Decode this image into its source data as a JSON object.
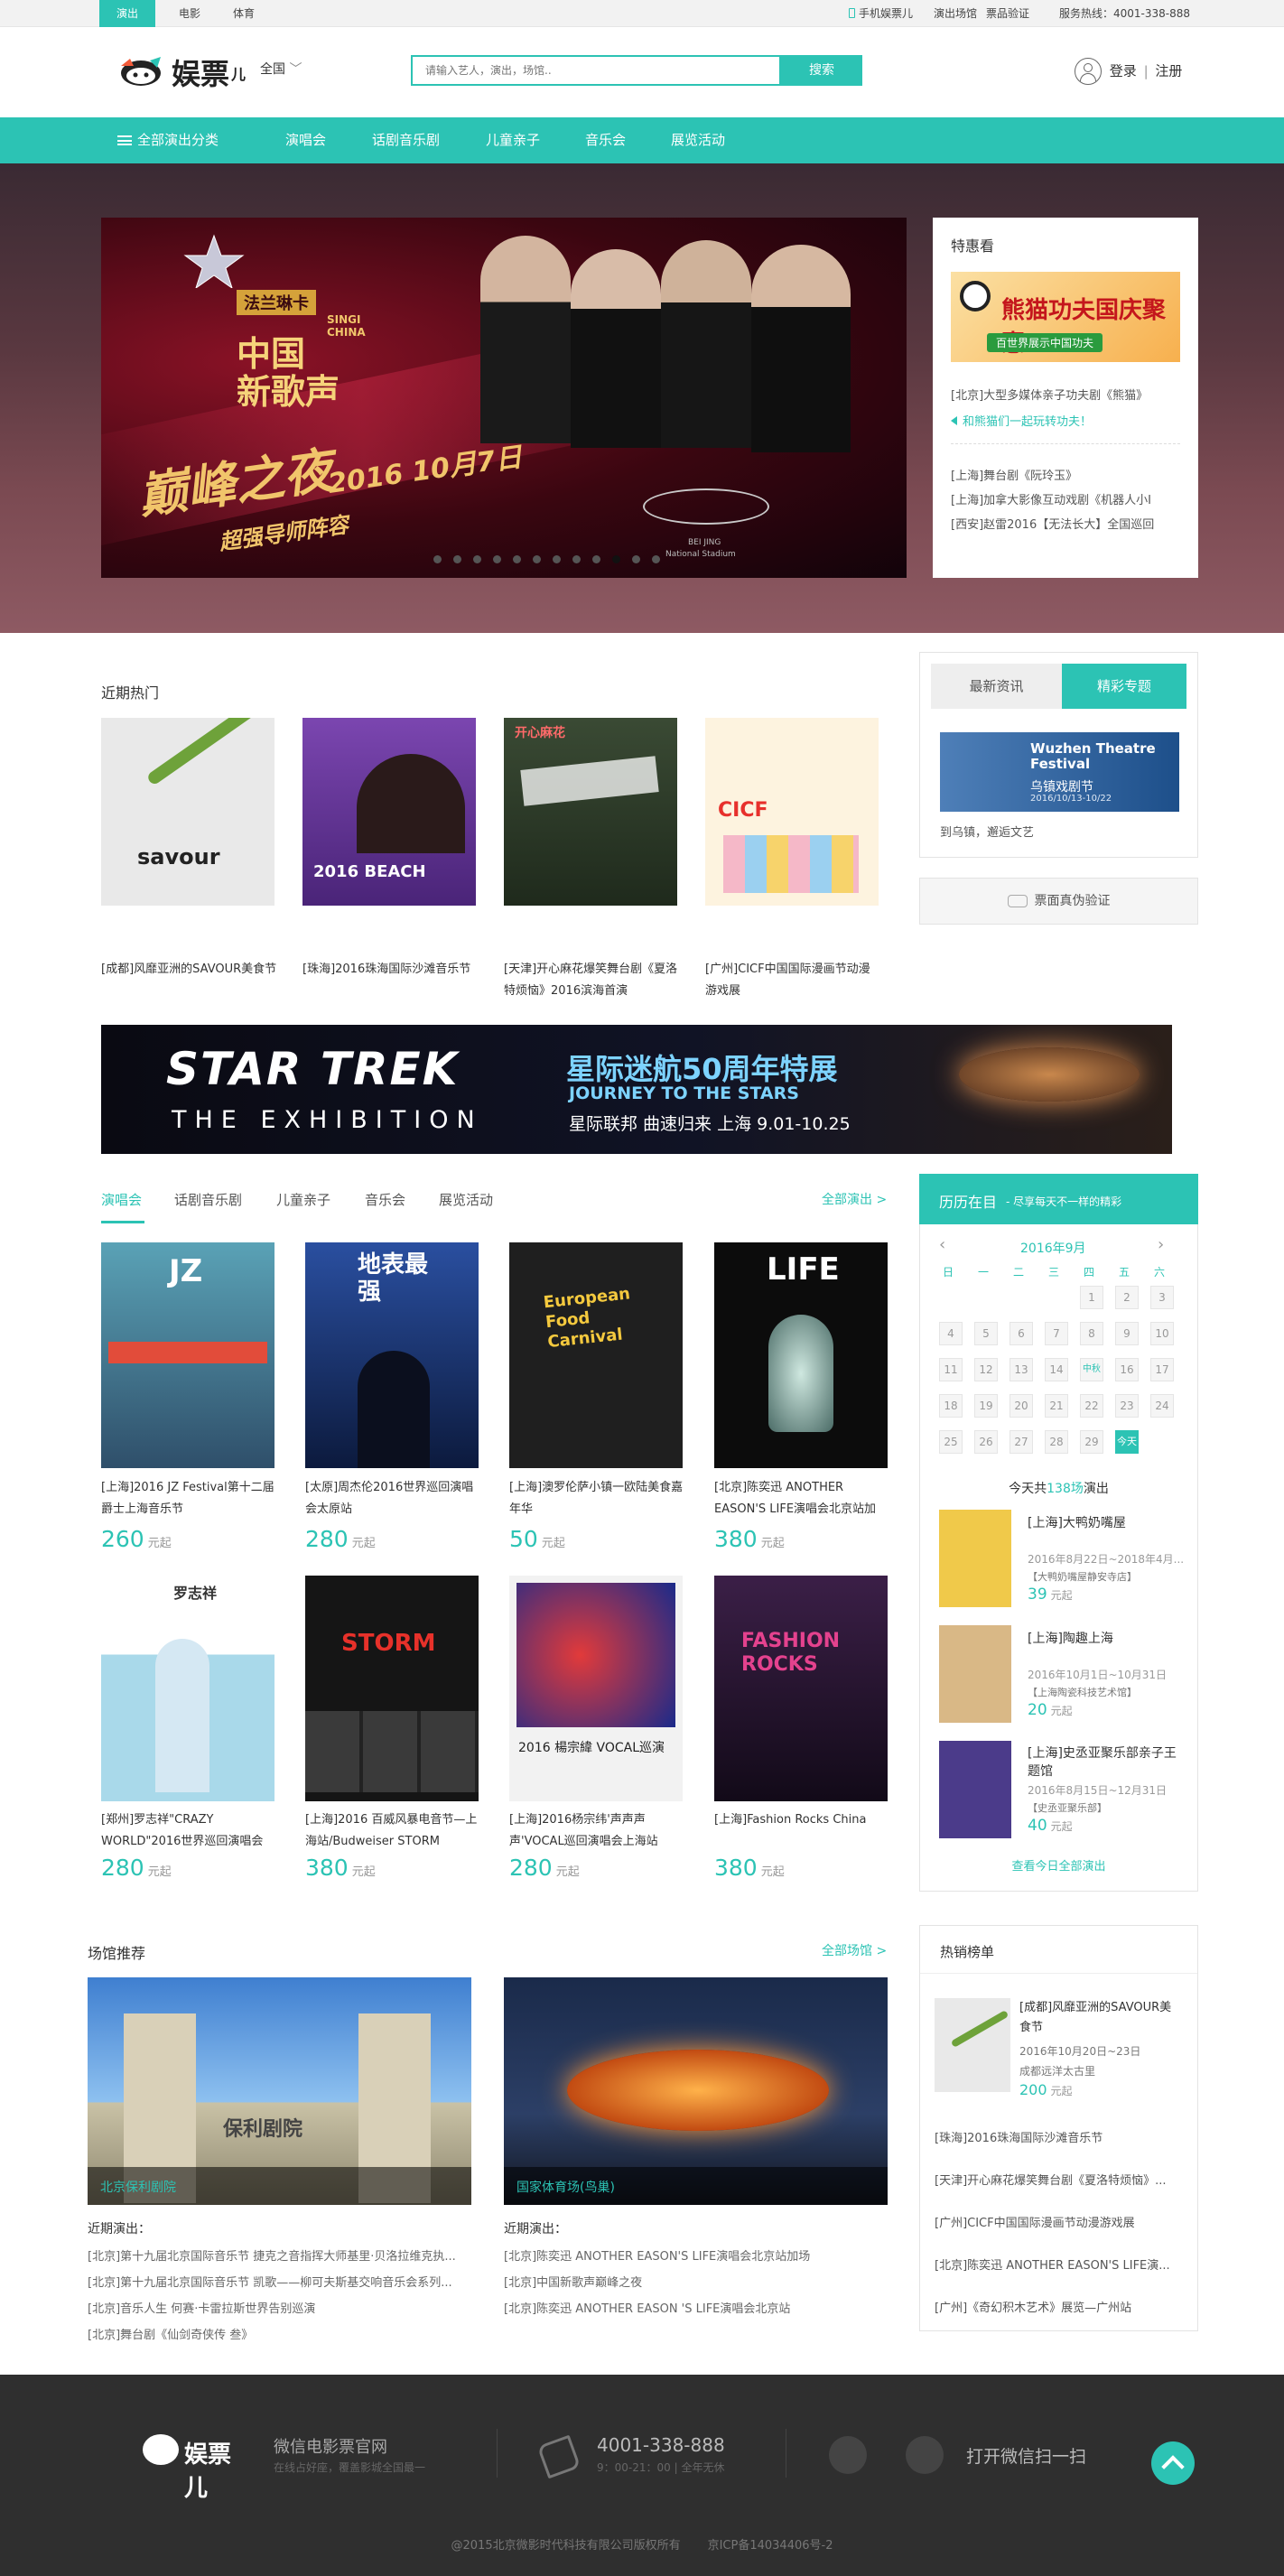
{
  "topbar": {
    "tabs": [
      "演出",
      "电影",
      "体育"
    ],
    "mobile": "手机娱票儿",
    "venues": "演出场馆",
    "verify": "票品验证",
    "hotline": "服务热线：4001-338-888"
  },
  "header": {
    "logo_text": "娱票",
    "logo_sub": "儿",
    "city": "全国",
    "search_placeholder": "请输入艺人，演出，场馆..",
    "search_button": "搜索",
    "login": "登录",
    "divider": "|",
    "register": "注册"
  },
  "nav": {
    "all_categories": "全部演出分类",
    "items": [
      "演唱会",
      "话剧音乐剧",
      "儿童亲子",
      "音乐会",
      "展览活动"
    ]
  },
  "hero": {
    "brand_en": "SINGI CHINA",
    "brand": "法兰琳卡",
    "title_1": "中国",
    "title_2": "新歌声",
    "event_title": "巅峰之夜",
    "date": "2016 10月7日",
    "subtitle": "超强导师阵容",
    "venue_en": "BEI JING",
    "venue": "National Stadium"
  },
  "tehui": {
    "title": "特惠看",
    "banner_text": "熊猫功夫国庆聚惠",
    "banner_sub": "百世界展示中国功夫",
    "items": [
      "[北京]大型多媒体亲子功夫剧《熊猫》",
      "和熊猫们一起玩转功夫！",
      "[上海]舞台剧《阮玲玉》",
      "[上海]加拿大影像互动戏剧《机器人小I",
      "[西安]赵雷2016【无法长大】全国巡回"
    ]
  },
  "hot": {
    "title": "近期热门",
    "items": [
      {
        "caption": "[成都]风靡亚洲的SAVOUR美食节",
        "poster_text": "savour",
        "color": "#e6e6e6"
      },
      {
        "caption": "[珠海]2016珠海国际沙滩音乐节",
        "poster_text": "2016 BEACH",
        "color": "#6a3fa0"
      },
      {
        "caption": "[天津]开心麻花爆笑舞台剧《夏洛特烦恼》2016滨海首演",
        "poster_text": "开心麻花",
        "color": "#2f3a2c"
      },
      {
        "caption": "[广州]CICF中国国际漫画节动漫游戏展",
        "poster_text": "CICF",
        "color": "#fde9c8"
      }
    ]
  },
  "tabs_panel": {
    "tab_news": "最新资讯",
    "tab_feature": "精彩专题",
    "festival_en": "Wuzhen Theatre Festival",
    "festival_cn": "乌镇戏剧节",
    "festival_date": "2016/10/13-10/22",
    "festival_caption": "到乌镇，邂逅文艺",
    "verify_button": "票面真伪验证"
  },
  "star_trek": {
    "logo": "STAR TREK",
    "sub": "THE EXHIBITION",
    "cn_title": "星际迷航50周年特展",
    "en_sub": "JOURNEY TO THE STARS",
    "cn_sub": "星际联邦 曲速归来 上海 9.01-10.25"
  },
  "shows": {
    "tabs": [
      "演唱会",
      "话剧音乐剧",
      "儿童亲子",
      "音乐会",
      "展览活动"
    ],
    "all_link": "全部演出 >",
    "currency_suffix": "元起",
    "items": [
      {
        "caption": "[上海]2016 JZ Festival第十二届爵士上海音乐节",
        "price": "260",
        "poster_text": "JZ",
        "color": "#4b7d8f"
      },
      {
        "caption": "[太原]周杰伦2016世界巡回演唱会太原站",
        "price": "280",
        "poster_text": "地表最强",
        "color": "#223c7a"
      },
      {
        "caption": "[上海]澳罗伦萨小镇一欧陆美食嘉年华",
        "price": "50",
        "poster_text": "European Food Carnival",
        "color": "#1f1f1f"
      },
      {
        "caption": "[北京]陈奕迅 ANOTHER EASON'S LIFE演唱会北京站加",
        "price": "380",
        "poster_text": "LIFE",
        "color": "#0c0c0c"
      },
      {
        "caption": "[郑州]罗志祥\"CRAZY WORLD\"2016世界巡回演唱会",
        "price": "280",
        "poster_text": "罗志祥",
        "color": "#9bd1e0"
      },
      {
        "caption": "[上海]2016 百威风暴电音节—上海站/Budweiser STORM",
        "price": "380",
        "poster_text": "STORM",
        "color": "#151515"
      },
      {
        "caption": "[上海]2016杨宗纬'声声声声'VOCAL巡回演唱会上海站",
        "price": "280",
        "poster_text": "2016 楊宗緯 VOCAL巡演",
        "color": "#f2f2f2"
      },
      {
        "caption": "[上海]Fashion Rocks China",
        "price": "380",
        "poster_text": "FASHION ROCKS",
        "color": "#2a1533"
      }
    ]
  },
  "calendar": {
    "title": "历历在目",
    "subtitle": "- 尽享每天不一样的精彩",
    "month": "2016年9月",
    "prev": "‹",
    "next": "›",
    "weekdays": [
      "日",
      "一",
      "二",
      "三",
      "四",
      "五",
      "六"
    ],
    "days": [
      "",
      "",
      "",
      "",
      "1",
      "2",
      "3",
      "4",
      "5",
      "6",
      "7",
      "8",
      "9",
      "10",
      "11",
      "12",
      "13",
      "14",
      "中秋",
      "16",
      "17",
      "18",
      "19",
      "20",
      "21",
      "22",
      "23",
      "24",
      "25",
      "26",
      "27",
      "28",
      "29",
      "今天",
      ""
    ],
    "today_prefix": "今天共",
    "today_count": "138场",
    "today_suffix": "演出",
    "events": [
      {
        "title": "[上海]大鸭奶嘴屋",
        "date": "2016年8月22日~2018年4月...",
        "venue": "【大鸭奶嘴屋静安寺店】",
        "price": "39",
        "color": "#f0c94a"
      },
      {
        "title": "[上海]陶趣上海",
        "date": "2016年10月1日~10月31日",
        "venue": "【上海陶瓷科技艺术馆】",
        "price": "20",
        "color": "#d9b886"
      },
      {
        "title": "[上海]史丞亚聚乐部亲子王题馆",
        "date": "2016年8月15日~12月31日",
        "venue": "【史丞亚聚乐部】",
        "price": "40",
        "color": "#4b3b8a"
      }
    ],
    "all_today": "查看今日全部演出"
  },
  "venues": {
    "title": "场馆推荐",
    "all_link": "全部场馆 >",
    "recent_label": "近期演出：",
    "items": [
      {
        "name": "北京保利剧院",
        "photo_text": "保利剧院",
        "shows": [
          "[北京]第十九届北京国际音乐节 捷克之音指挥大师基里·贝洛拉维克执...",
          "[北京]第十九届北京国际音乐节 凯歌——柳可夫斯基交响音乐会系列...",
          "[北京]音乐人生 何赛·卡雷拉斯世界告别巡演",
          "[北京]舞台剧《仙剑奇侠传 叁》"
        ]
      },
      {
        "name": "国家体育场(鸟巢)",
        "photo_text": "",
        "shows": [
          "[北京]陈奕迅 ANOTHER EASON'S LIFE演唱会北京站加场",
          "[北京]中国新歌声巅峰之夜",
          "[北京]陈奕迅 ANOTHER EASON 'S LIFE演唱会北京站"
        ]
      }
    ]
  },
  "ranking": {
    "title": "热销榜单",
    "top": {
      "title": "[成都]风靡亚洲的SAVOUR美食节",
      "date": "2016年10月20日~23日",
      "venue": "成都远洋太古里",
      "price": "200",
      "suffix": "元起"
    },
    "items": [
      "[珠海]2016珠海国际沙滩音乐节",
      "[天津]开心麻花爆笑舞台剧《夏洛特烦恼》...",
      "[广州]CICF中国国际漫画节动漫游戏展",
      "[北京]陈奕迅 ANOTHER EASON'S LIFE演...",
      "[广州]《奇幻积木艺术》展览—广州站"
    ]
  },
  "footer": {
    "logo_text": "娱票儿",
    "wechat_title": "微信电影票官网",
    "wechat_sub": "在线占好座，覆盖影城全国最一",
    "phone": "4001-338-888",
    "phone_sub": "9：00-21：00 | 全年无休",
    "scan": "打开微信扫一扫",
    "copyright": "@2015北京微影时代科技有限公司版权所有",
    "icp": "京ICP备14034406号-2"
  },
  "colors": {
    "accent": "#2cc3b4",
    "footer_bg": "#2f2f2f"
  }
}
